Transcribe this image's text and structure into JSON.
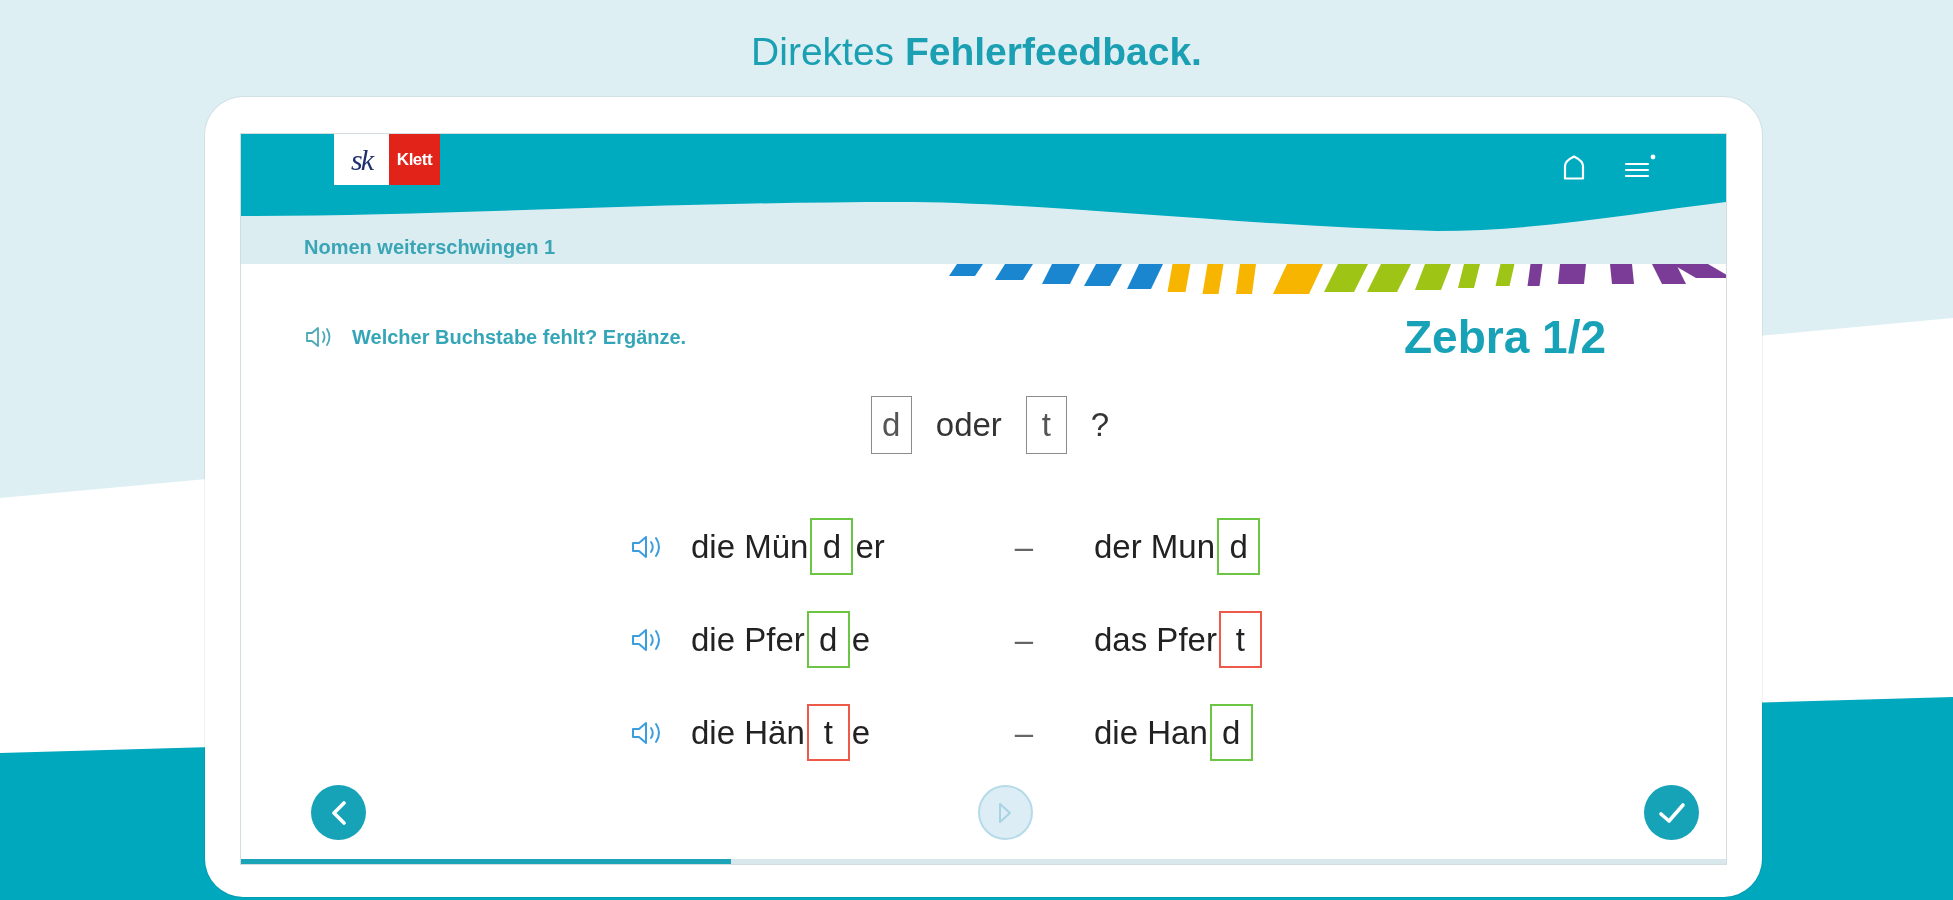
{
  "headline": "Direktes **Fehlerfeedback.**",
  "header": {
    "logo": {
      "mark": "sk",
      "wordmark": "Klett"
    },
    "breadcrumb": "Nomen weiterschwingen 1"
  },
  "exercise": {
    "instruction": "Welcher Buchstabe fehlt? Ergänze.",
    "title": "Zebra 1/2",
    "choice_line": [
      {
        "kind": "tile",
        "text": "d"
      },
      {
        "kind": "word",
        "text": "oder"
      },
      {
        "kind": "tile",
        "text": "t"
      },
      {
        "kind": "word",
        "text": "?"
      }
    ],
    "rows": [
      {
        "left": [
          {
            "kind": "text",
            "text": "die Mün"
          },
          {
            "kind": "answer",
            "text": "d",
            "correct": true
          },
          {
            "kind": "text",
            "text": "er"
          }
        ],
        "dash": "–",
        "right": [
          {
            "kind": "text",
            "text": "der Mun"
          },
          {
            "kind": "answer",
            "text": "d",
            "correct": true
          }
        ]
      },
      {
        "left": [
          {
            "kind": "text",
            "text": "die Pfer"
          },
          {
            "kind": "answer",
            "text": "d",
            "correct": true
          },
          {
            "kind": "text",
            "text": "e"
          }
        ],
        "dash": "–",
        "right": [
          {
            "kind": "text",
            "text": "das Pfer"
          },
          {
            "kind": "answer",
            "text": "t",
            "correct": false
          }
        ]
      },
      {
        "left": [
          {
            "kind": "text",
            "text": "die Hän"
          },
          {
            "kind": "answer",
            "text": "t",
            "correct": false
          },
          {
            "kind": "text",
            "text": "e"
          }
        ],
        "dash": "–",
        "right": [
          {
            "kind": "text",
            "text": "die Han"
          },
          {
            "kind": "answer",
            "text": "d",
            "correct": true
          }
        ]
      }
    ]
  },
  "navigation": [
    {
      "kind": "back",
      "disabled": false
    },
    {
      "kind": "play",
      "disabled": true
    },
    {
      "kind": "check",
      "disabled": false
    }
  ],
  "progress": {
    "level": 0.33
  }
}
